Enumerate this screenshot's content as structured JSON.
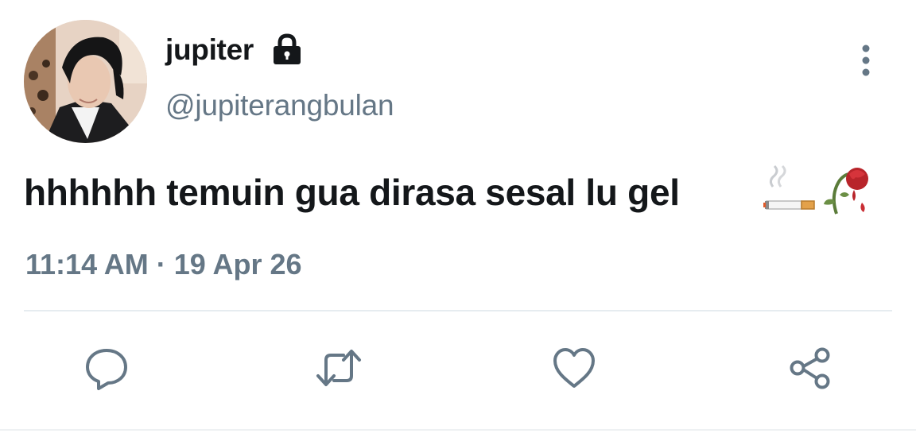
{
  "tweet": {
    "author": {
      "display_name": "jupiter",
      "handle": "@jupiterangbulan",
      "protected_icon": "lock-icon",
      "avatar": "profile-photo"
    },
    "text": "hhhhhh temuin gua dirasa sesal lu gel",
    "emojis": [
      "cigarette-emoji",
      "wilted-flower-emoji"
    ],
    "time": "11:14 AM",
    "separator": "·",
    "date": "19 Apr 26"
  },
  "actions": [
    {
      "name": "reply",
      "icon": "reply-icon"
    },
    {
      "name": "retweet",
      "icon": "retweet-icon"
    },
    {
      "name": "like",
      "icon": "heart-icon"
    },
    {
      "name": "share",
      "icon": "share-icon"
    }
  ],
  "more_icon": "more-vertical-icon",
  "colors": {
    "text_primary": "#14171a",
    "text_secondary": "#657786",
    "divider": "#e6ecf0"
  }
}
